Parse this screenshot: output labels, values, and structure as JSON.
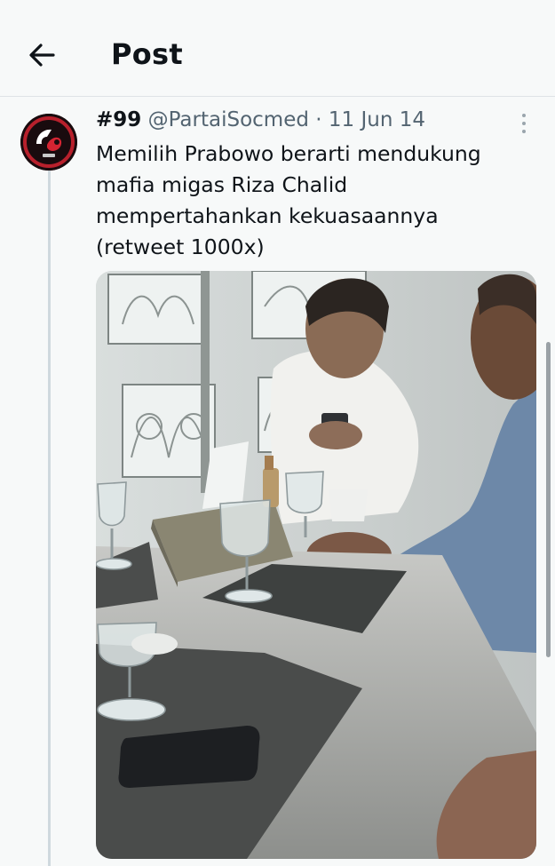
{
  "header": {
    "title": "Post",
    "back_icon": "arrow-left-icon"
  },
  "post": {
    "author_name": "#99",
    "author_handle": "@PartaiSocmed",
    "separator": "·",
    "date": "11 Jun 14",
    "text": "Memilih Prabowo berarti mendukung\nmafia migas Riza Chalid\nmempertahankan kekuasaannya\n(retweet 1000x)",
    "more_icon": "more-vertical-icon",
    "avatar_icon": "party-logo-avatar",
    "media_icon": "photo-image"
  },
  "colors": {
    "background": "#f7f9f9",
    "text_primary": "#0f1419",
    "text_secondary": "#536471",
    "divider": "#dfe3e6"
  }
}
